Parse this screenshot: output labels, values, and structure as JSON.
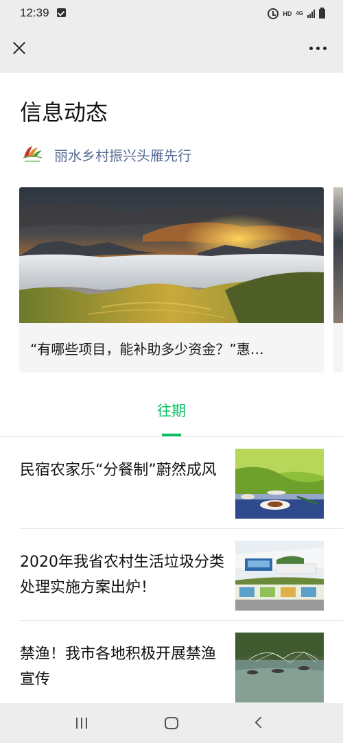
{
  "status_bar": {
    "time": "12:39",
    "hd": "HD",
    "network": "4G"
  },
  "nav": {
    "close_icon": "close-icon",
    "more_icon": "more-icon"
  },
  "page": {
    "title": "信息动态"
  },
  "account": {
    "name": "丽水乡村振兴头雁先行"
  },
  "featured": {
    "title": "“有哪些项目，能补助多少资金？”惠…"
  },
  "tabs": {
    "past_label": "往期"
  },
  "articles": [
    {
      "title": "民宿农家乐“分餐制”蔚然成风"
    },
    {
      "title": "2020年我省农村生活垃圾分类处理实施方案出炉！"
    },
    {
      "title": "禁渔！我市各地积极开展禁渔宣传"
    }
  ],
  "colors": {
    "accent": "#07c160",
    "link": "#576b95",
    "bar_bg": "#ededed"
  }
}
